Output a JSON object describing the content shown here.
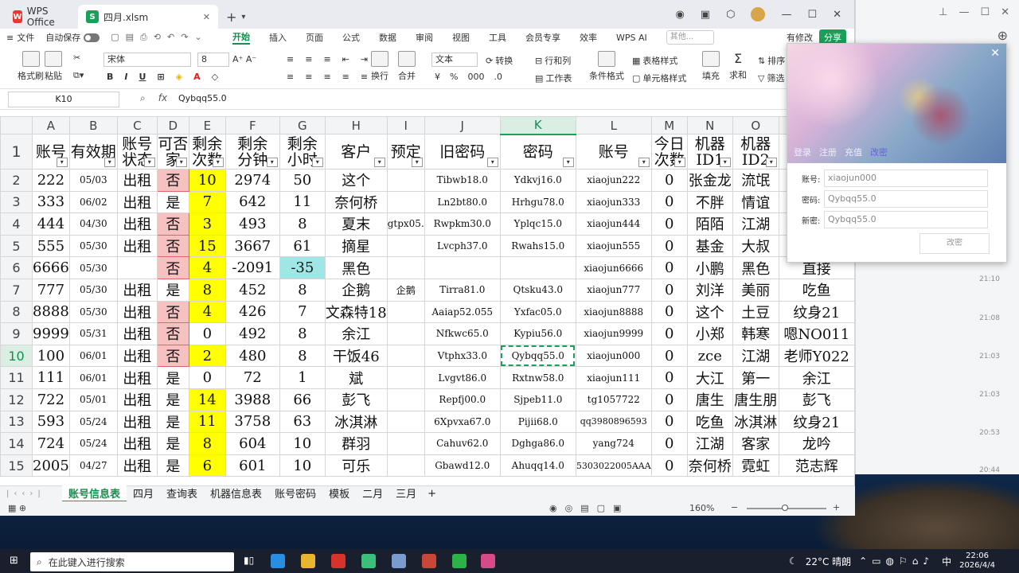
{
  "tabs": {
    "home": "WPS Office",
    "file": "四月.xlsm"
  },
  "menu": {
    "file": "文件",
    "autosave": "自动保存",
    "tabs": [
      "开始",
      "插入",
      "页面",
      "公式",
      "数据",
      "审阅",
      "视图",
      "工具",
      "会员专享",
      "效率",
      "WPS AI"
    ],
    "search": "其他...",
    "modify": "有修改",
    "share": "分享"
  },
  "ribbon": {
    "painter": "格式刷",
    "paste": "粘贴",
    "font": "宋体",
    "size": "8",
    "format": "文本",
    "convert": "转换",
    "rowcol": "行和列",
    "worksheet": "工作表",
    "cond": "条件格式",
    "tablestyle": "表格样式",
    "cellstyle": "单元格样式",
    "fill": "填充",
    "sum": "求和",
    "sort": "排序",
    "filter": "筛选",
    "wrap": "换行",
    "merge": "合并"
  },
  "formula": {
    "cell": "K10",
    "value": "Qybqq55.0"
  },
  "columns": [
    "A",
    "B",
    "C",
    "D",
    "E",
    "F",
    "G",
    "H",
    "I",
    "J",
    "K",
    "L",
    "M",
    "N",
    "O"
  ],
  "headers": [
    "账号",
    "有效期",
    "账号状态",
    "可否家",
    "剩余次数",
    "剩余分钟",
    "剩余小时",
    "客户",
    "预定",
    "旧密码",
    "密码",
    "账号",
    "今日次数",
    "机器ID1",
    "机器ID2"
  ],
  "header_display": [
    [
      "账号"
    ],
    [
      "有效期"
    ],
    [
      "账号",
      "状态"
    ],
    [
      "可否",
      "家"
    ],
    [
      "剩余",
      "次数"
    ],
    [
      "剩余",
      "分钟"
    ],
    [
      "剩余",
      "小时"
    ],
    [
      "客户"
    ],
    [
      "预定"
    ],
    [
      "旧密码"
    ],
    [
      "密码"
    ],
    [
      "账号"
    ],
    [
      "今日",
      "次数"
    ],
    [
      "机器",
      "ID1"
    ],
    [
      "机器",
      "ID2"
    ]
  ],
  "rows": [
    {
      "n": "2",
      "c": [
        "222",
        "05/03",
        "出租",
        "否",
        "10",
        "2974",
        "50",
        "这个",
        "",
        "Tibwb18.0",
        "Ydkvj16.0",
        "xiaojun222",
        "0",
        "张金龙",
        "流氓"
      ]
    },
    {
      "n": "3",
      "c": [
        "333",
        "06/02",
        "出租",
        "是",
        "7",
        "642",
        "11",
        "奈何桥",
        "",
        "Ln2bt80.0",
        "Hrhgu78.0",
        "xiaojun333",
        "0",
        "不胖",
        "情谊"
      ]
    },
    {
      "n": "4",
      "c": [
        "444",
        "04/30",
        "出租",
        "否",
        "3",
        "493",
        "8",
        "夏末",
        "gtpx05.",
        "Rwpkm30.0",
        "Yplqc15.0",
        "xiaojun444",
        "0",
        "陌陌",
        "江湖"
      ]
    },
    {
      "n": "5",
      "c": [
        "555",
        "05/30",
        "出租",
        "否",
        "15",
        "3667",
        "61",
        "摘星",
        "",
        "Lvcph37.0",
        "Rwahs15.0",
        "xiaojun555",
        "0",
        "基金",
        "大叔"
      ]
    },
    {
      "n": "6",
      "c": [
        "6666",
        "05/30",
        "",
        "否",
        "4",
        "-2091",
        "-35",
        "黑色",
        "",
        "",
        "",
        "xiaojun6666",
        "0",
        "小鹏",
        "黑色",
        "直接"
      ]
    },
    {
      "n": "7",
      "c": [
        "777",
        "05/30",
        "出租",
        "是",
        "8",
        "452",
        "8",
        "企鹅",
        "企鹅",
        "Tirra81.0",
        "Qtsku43.0",
        "xiaojun777",
        "0",
        "刘洋",
        "美丽",
        "吃鱼"
      ]
    },
    {
      "n": "8",
      "c": [
        "8888",
        "05/30",
        "出租",
        "否",
        "4",
        "426",
        "7",
        "文森特18",
        "",
        "Aaiap52.055",
        "Yxfac05.0",
        "xiaojun8888",
        "0",
        "这个",
        "土豆",
        "纹身21"
      ]
    },
    {
      "n": "9",
      "c": [
        "9999",
        "05/31",
        "出租",
        "否",
        "0",
        "492",
        "8",
        "余江",
        "",
        "Nfkwc65.0",
        "Kypiu56.0",
        "xiaojun9999",
        "0",
        "小郑",
        "韩寒",
        "嗯NO011"
      ]
    },
    {
      "n": "10",
      "c": [
        "100",
        "06/01",
        "出租",
        "否",
        "2",
        "480",
        "8",
        "干饭46",
        "",
        "Vtphx33.0",
        "Qybqq55.0",
        "xiaojun000",
        "0",
        "zce",
        "江湖",
        "老师Y022"
      ]
    },
    {
      "n": "11",
      "c": [
        "111",
        "06/01",
        "出租",
        "是",
        "0",
        "72",
        "1",
        "斌",
        "",
        "Lvgvt86.0",
        "Rxtnw58.0",
        "xiaojun111",
        "0",
        "大江",
        "第一",
        "余江"
      ]
    },
    {
      "n": "12",
      "c": [
        "722",
        "05/01",
        "出租",
        "是",
        "14",
        "3988",
        "66",
        "彭飞",
        "",
        "Repfj00.0",
        "Sjpeb11.0",
        "tg1057722",
        "0",
        "唐生",
        "唐生朋",
        "彭飞"
      ]
    },
    {
      "n": "13",
      "c": [
        "593",
        "05/24",
        "出租",
        "是",
        "11",
        "3758",
        "63",
        "冰淇淋",
        "",
        "6Xpvxa67.0",
        "Pijii68.0",
        "qq3980896593",
        "0",
        "吃鱼",
        "冰淇淋",
        "纹身21"
      ]
    },
    {
      "n": "14",
      "c": [
        "724",
        "05/24",
        "出租",
        "是",
        "8",
        "604",
        "10",
        "群羽",
        "",
        "Cahuv62.0",
        "Dghga86.0",
        "yang724",
        "0",
        "江湖",
        "客家",
        "龙吟"
      ]
    },
    {
      "n": "15",
      "c": [
        "2005",
        "04/27",
        "出租",
        "是",
        "6",
        "601",
        "10",
        "可乐",
        "",
        "Gbawd12.0",
        "Ahuqq14.0",
        "5303022005AAA",
        "0",
        "奈何桥",
        "霓虹",
        "范志辉"
      ]
    }
  ],
  "sheets": [
    "账号信息表",
    "四月",
    "查询表",
    "机器信息表",
    "账号密码",
    "模板",
    "二月",
    "三月"
  ],
  "zoom": "160%",
  "popup": {
    "tabs": [
      "登录",
      "注册",
      "充值",
      "改密"
    ],
    "account_label": "账号:",
    "account": "xiaojun000",
    "pwd_label": "密码:",
    "pwd": "Qybqq55.0",
    "newpwd_label": "新密:",
    "newpwd": "Qybqq55.0",
    "button": "改密"
  },
  "chat_times": [
    "21:10",
    "21:08",
    "21:03",
    "21:03",
    "20:53",
    "20:44"
  ],
  "taskbar": {
    "search": "在此键入进行搜索",
    "weather": "22°C 晴朗",
    "ime": "中",
    "time": "22:06",
    "date": "2026/4/4"
  },
  "colors": {
    "accent": "#1b9f5a",
    "no": "#f5c1c1",
    "remain": "#ffff00",
    "negative": "#9fe6e6"
  }
}
